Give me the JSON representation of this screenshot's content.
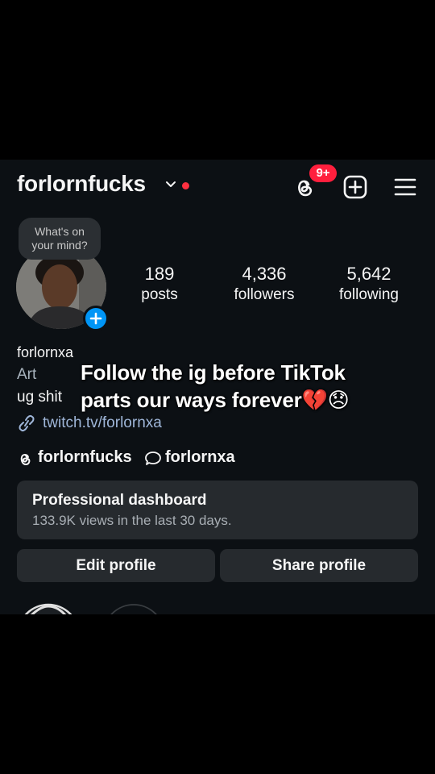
{
  "header": {
    "username": "forlornfucks",
    "notification_badge": "9+",
    "accent_red": "#ff3040",
    "icons": [
      "chevron-down-icon",
      "threads-icon",
      "plus-square-icon",
      "hamburger-menu-icon"
    ]
  },
  "note": {
    "text_line1": "What's on",
    "text_line2": "your mind?"
  },
  "stats": {
    "posts": {
      "value": "189",
      "label": "posts"
    },
    "followers": {
      "value": "4,336",
      "label": "followers"
    },
    "following": {
      "value": "5,642",
      "label": "following"
    }
  },
  "profile": {
    "display_name": "forlornxa",
    "category": "Art",
    "bio": "ug shit",
    "link": "twitch.tv/forlornxa"
  },
  "social": {
    "threads_handle": "forlornfucks",
    "ig_handle": "forlornxa"
  },
  "dashboard": {
    "title": "Professional dashboard",
    "subtitle": "133.9K views in the last 30 days."
  },
  "buttons": {
    "edit": "Edit profile",
    "share": "Share profile"
  },
  "overlay_caption": {
    "line1": "Follow the ig before TikTok",
    "line2": "parts our ways forever💔😞"
  },
  "colors": {
    "background": "#0c1014",
    "button_bg": "#262a2e",
    "link": "#9fb6d8",
    "add_blue": "#0095f6"
  }
}
